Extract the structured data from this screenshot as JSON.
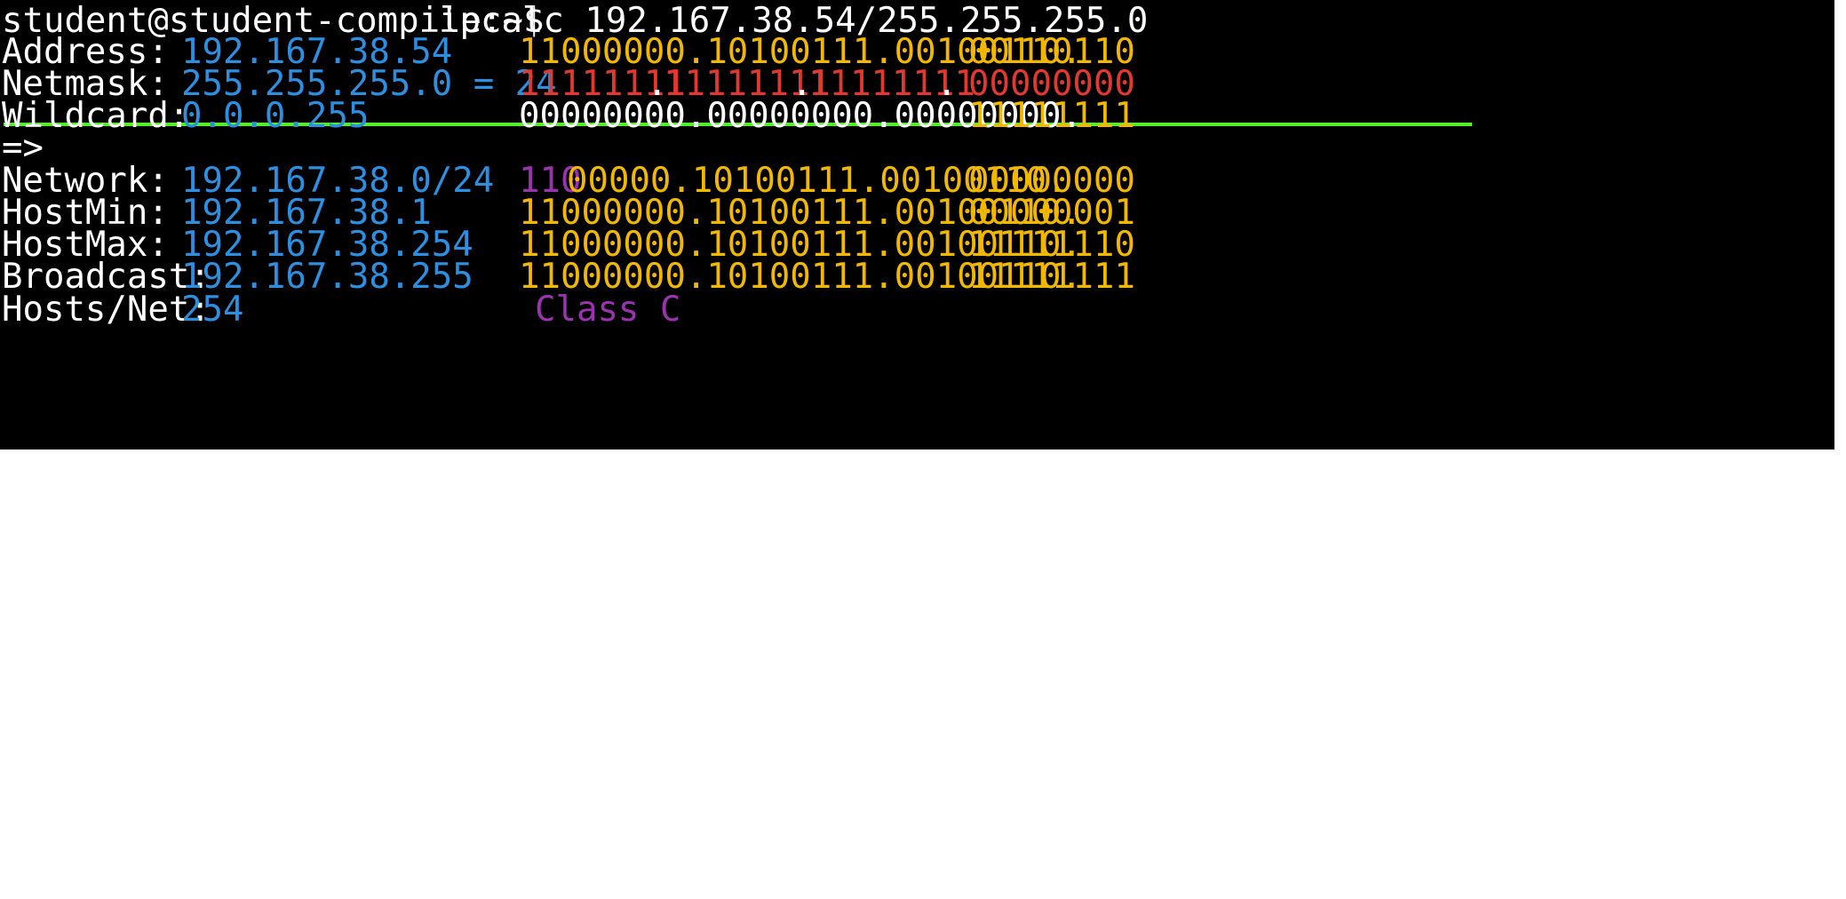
{
  "prompt": {
    "user_host": "student@student-compile:~$",
    "command": "ipcalc 192.167.38.54/255.255.255.0"
  },
  "rows": {
    "address": {
      "label": "Address:",
      "value": "192.167.38.54",
      "bin_a": "11000000.10100111.00100110.",
      "bin_b": "00110110"
    },
    "netmask": {
      "label": "Netmask:",
      "value": "255.255.255.0 = 24",
      "oct1": "11111111",
      "dot1": ".",
      "oct2": "11111111",
      "dot2": ".",
      "oct3": "11111111",
      "dot3": ".",
      "oct4": "00000000"
    },
    "wildcard": {
      "label": "Wildcard:",
      "value": "0.0.0.255",
      "bin_a": "00000000.00000000.00000000.",
      "bin_b": "11111111"
    },
    "arrow": {
      "label": "=>"
    },
    "network": {
      "label": "Network:",
      "value": "192.167.38.0/24",
      "class_bits": "110",
      "bin_a": "00000.10100111.00100110.",
      "bin_b": "00000000"
    },
    "hostmin": {
      "label": "HostMin:",
      "value": "192.167.38.1",
      "bin_a": "11000000.10100111.00100110.",
      "bin_b": "00000001"
    },
    "hostmax": {
      "label": "HostMax:",
      "value": "192.167.38.254",
      "bin_a": "11000000.10100111.00100110.",
      "bin_b": "11111110"
    },
    "broadcast": {
      "label": "Broadcast:",
      "value": "192.167.38.255",
      "bin_a": "11000000.10100111.00100110.",
      "bin_b": "11111111"
    },
    "hosts": {
      "label": "Hosts/Net:",
      "value": "254",
      "class": "Class C"
    }
  },
  "colors": {
    "background": "#000000",
    "text": "#ffffff",
    "value": "#2d8fe0",
    "binary": "#f2b800",
    "mask": "#e2382f",
    "class": "#9b33b0",
    "highlight_line": "#55ee2a"
  }
}
